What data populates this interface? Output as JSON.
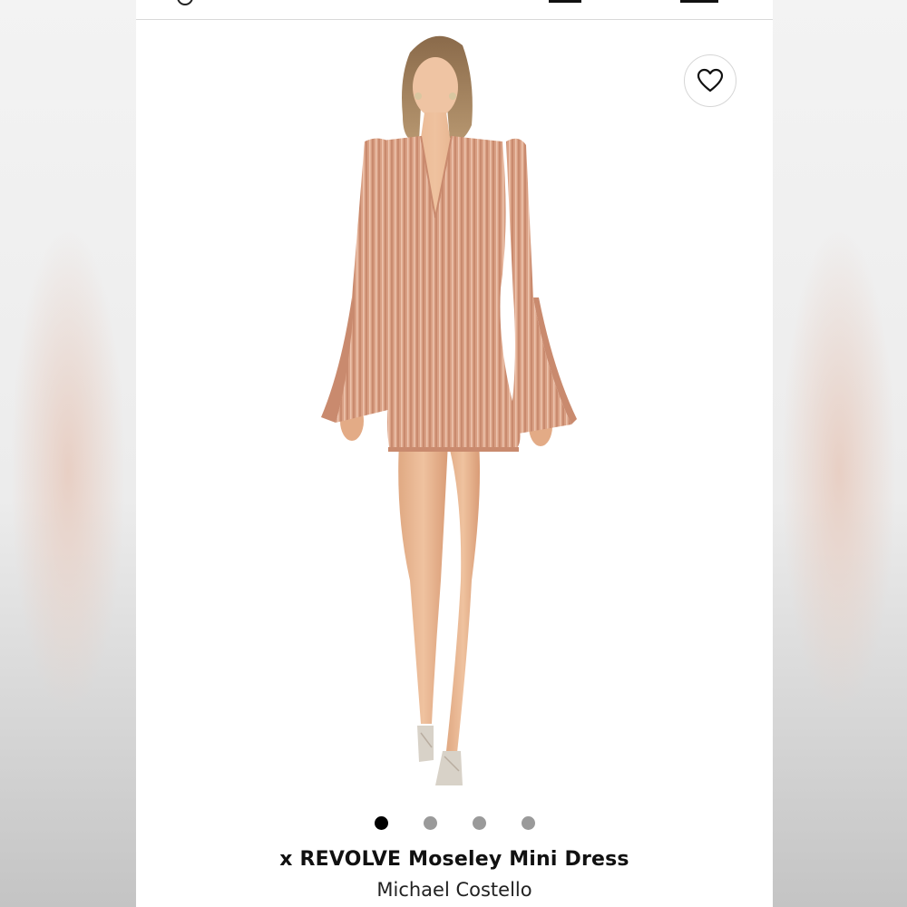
{
  "header": {
    "back_icon": "chevron-icon",
    "bag_icon": "shopping-bag-icon",
    "menu_icon": "menu-icon"
  },
  "product": {
    "title": "x REVOLVE Moseley Mini Dress",
    "brand": "Michael Costello",
    "favorite_icon": "heart-icon",
    "image": {
      "subject": "model-in-dress",
      "dress_color": "#d9a084"
    }
  },
  "gallery": {
    "dot_count": 4,
    "active_index": 0
  },
  "colors": {
    "active_dot": "#000000",
    "inactive_dot": "#9a9a9a"
  }
}
